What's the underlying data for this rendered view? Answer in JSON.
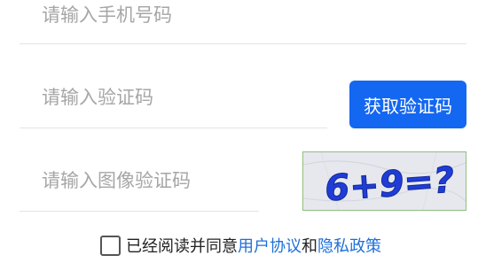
{
  "phone": {
    "placeholder": "请输入手机号码"
  },
  "sms_code": {
    "placeholder": "请输入验证码",
    "button_label": "获取验证码"
  },
  "image_code": {
    "placeholder": "请输入图像验证码",
    "captcha_text": "6+9=?"
  },
  "agreement": {
    "prefix": "已经阅读并同意",
    "user_agreement": "用户协议",
    "conjunction": "和",
    "privacy_policy": "隐私政策"
  },
  "colors": {
    "primary": "#1467f0",
    "link": "#1e6fd9",
    "placeholder": "#a6a6a6",
    "captcha_ink": "#1f3dd6"
  }
}
